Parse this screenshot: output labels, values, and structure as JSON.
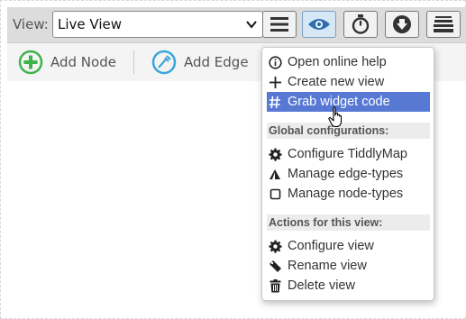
{
  "toolbar": {
    "view_label": "View:",
    "view_select_value": "Live View",
    "buttons": [
      "menu-icon",
      "eye-icon",
      "stopwatch-icon",
      "download-circle-icon",
      "stack-icon"
    ]
  },
  "edge_bar": {
    "add_node_label": "Add Node",
    "add_edge_label": "Add Edge"
  },
  "menu": {
    "items_top": [
      {
        "icon": "info-icon",
        "label": "Open online help"
      },
      {
        "icon": "plus-icon",
        "label": "Create new view"
      },
      {
        "icon": "hash-icon",
        "label": "Grab widget code"
      }
    ],
    "header_global": "Global configurations:",
    "items_global": [
      {
        "icon": "gear-icon",
        "label": "Configure TiddlyMap"
      },
      {
        "icon": "triangle-icon",
        "label": "Manage edge-types"
      },
      {
        "icon": "square-icon",
        "label": "Manage node-types"
      }
    ],
    "header_view": "Actions for this view:",
    "items_view": [
      {
        "icon": "gear-icon",
        "label": "Configure view"
      },
      {
        "icon": "tag-icon",
        "label": "Rename view"
      },
      {
        "icon": "trash-icon",
        "label": "Delete view"
      }
    ]
  },
  "colors": {
    "highlight": "#5778d3",
    "accent_green": "#3cb44a",
    "accent_blue": "#3aa6dc"
  }
}
